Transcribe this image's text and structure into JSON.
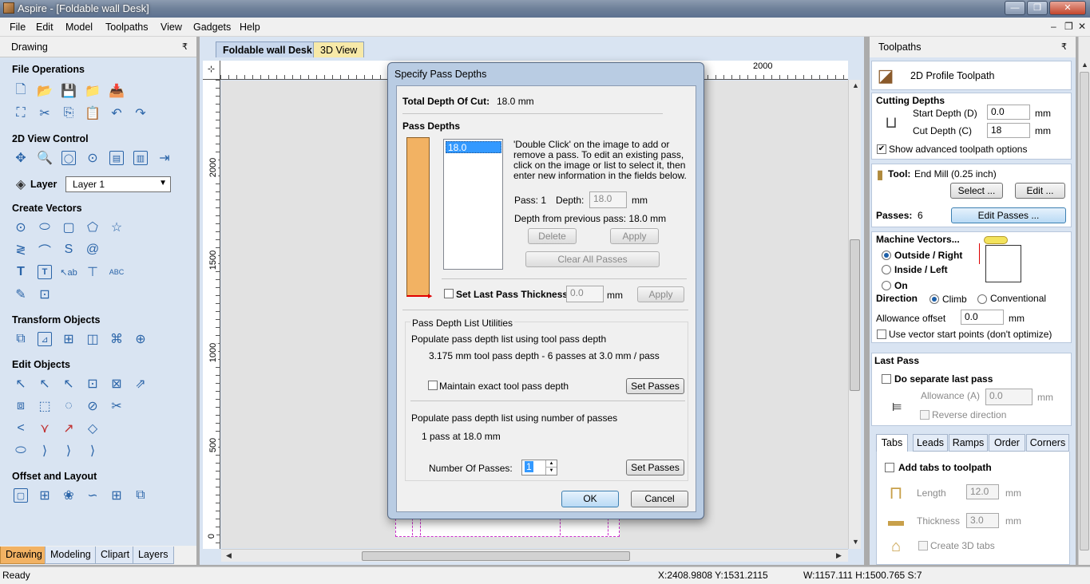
{
  "window": {
    "title": "Aspire - [Foldable wall Desk]",
    "min": "—",
    "restore": "❐",
    "close": "✕"
  },
  "menu": [
    "File",
    "Edit",
    "Model",
    "Toolpaths",
    "View",
    "Gadgets",
    "Help"
  ],
  "mdi_controls": {
    "min": "–",
    "restore": "❐",
    "close": "✕"
  },
  "left_panel": {
    "header": "Drawing",
    "pin": "₹",
    "sections": {
      "file_operations": "File Operations",
      "view_control": "2D View Control",
      "create_vectors": "Create Vectors",
      "transform": "Transform Objects",
      "edit_objects": "Edit Objects",
      "offset_layout": "Offset and Layout"
    },
    "layer_label": "Layer",
    "layer_value": "Layer 1",
    "bottom_tabs": [
      "Drawing",
      "Modeling",
      "Clipart",
      "Layers"
    ]
  },
  "doc_tabs": [
    "Foldable wall Desk",
    "3D View"
  ],
  "ruler": {
    "top_mark": "2000",
    "left_marks": [
      "2000",
      "1500",
      "1000",
      "500",
      "0"
    ]
  },
  "dialog": {
    "title": "Specify Pass Depths",
    "total_depth_label": "Total Depth Of Cut:",
    "total_depth_value": "18.0 mm",
    "pass_depths_title": "Pass Depths",
    "list_item": "18.0",
    "instructions": [
      "'Double Click' on the image to add or",
      "remove a pass. To edit an existing pass,",
      "click on the image or list to select it, then",
      "enter new information in the fields below."
    ],
    "pass_label": "Pass: 1",
    "depth_label": "Depth:",
    "depth_value": "18.0",
    "mm": "mm",
    "depth_from_prev": "Depth from previous pass:  18.0 mm",
    "delete": "Delete",
    "apply": "Apply",
    "clear_all": "Clear All Passes",
    "set_last_pass": "Set Last Pass Thickness",
    "last_pass_value": "0.0",
    "utilities_title": "Pass Depth List Utilities",
    "populate_tool": "Populate pass depth list using tool pass depth",
    "tool_summary": "3.175 mm tool pass depth - 6 passes at 3.0 mm / pass",
    "maintain_exact": "Maintain exact tool pass depth",
    "set_passes": "Set Passes",
    "populate_number": "Populate pass depth list using number of passes",
    "number_summary": "1 pass at 18.0 mm",
    "number_of_passes_label": "Number Of Passes:",
    "number_of_passes_value": "1",
    "ok": "OK",
    "cancel": "Cancel"
  },
  "right_panel": {
    "header": "Toolpaths",
    "pin": "₹",
    "toolpath_title": "2D Profile Toolpath",
    "cutting_depths": "Cutting Depths",
    "start_depth_label": "Start Depth (D)",
    "start_depth_value": "0.0",
    "cut_depth_label": "Cut Depth (C)",
    "cut_depth_value": "18",
    "mm": "mm",
    "show_advanced": "Show advanced toolpath options",
    "tool_label": "Tool:",
    "tool_value": "End Mill (0.25 inch)",
    "select_btn": "Select ...",
    "edit_btn": "Edit ...",
    "passes_label": "Passes:",
    "passes_value": "6",
    "edit_passes_btn": "Edit Passes ...",
    "machine_vectors": "Machine Vectors...",
    "outside_right": "Outside / Right",
    "inside_left": "Inside / Left",
    "on": "On",
    "direction": "Direction",
    "climb": "Climb",
    "conventional": "Conventional",
    "allowance_label": "Allowance offset",
    "allowance_value": "0.0",
    "use_vector_start": "Use vector start points (don't optimize)",
    "last_pass": "Last Pass",
    "do_separate": "Do separate last pass",
    "allowance_a_label": "Allowance (A)",
    "allowance_a_value": "0.0",
    "reverse_direction": "Reverse direction",
    "tabs": [
      "Tabs",
      "Leads",
      "Ramps",
      "Order",
      "Corners"
    ],
    "add_tabs": "Add tabs to toolpath",
    "length_label": "Length",
    "length_value": "12.0",
    "thickness_label": "Thickness",
    "thickness_value": "3.0",
    "create_3d_tabs": "Create 3D tabs"
  },
  "status": {
    "ready": "Ready",
    "coords": "X:2408.9808 Y:1531.2115",
    "size": "W:1157.111   H:1500.765  S:7"
  },
  "colors": {
    "accent_orange": "#F2B263",
    "panel_blue": "#D9E4F2",
    "icon_blue": "#2a64a8"
  }
}
